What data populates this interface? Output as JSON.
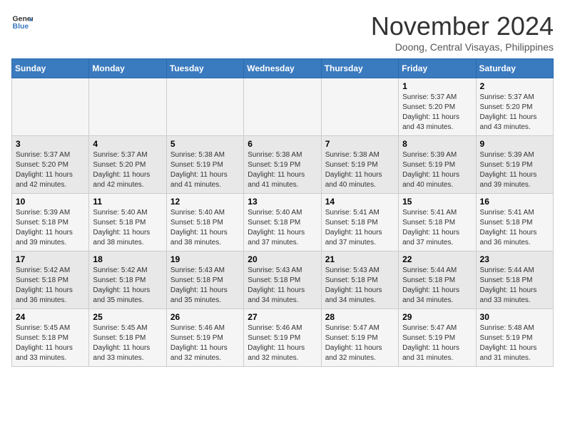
{
  "header": {
    "logo_line1": "General",
    "logo_line2": "Blue",
    "month": "November 2024",
    "location": "Doong, Central Visayas, Philippines"
  },
  "weekdays": [
    "Sunday",
    "Monday",
    "Tuesday",
    "Wednesday",
    "Thursday",
    "Friday",
    "Saturday"
  ],
  "weeks": [
    [
      {
        "day": "",
        "info": ""
      },
      {
        "day": "",
        "info": ""
      },
      {
        "day": "",
        "info": ""
      },
      {
        "day": "",
        "info": ""
      },
      {
        "day": "",
        "info": ""
      },
      {
        "day": "1",
        "info": "Sunrise: 5:37 AM\nSunset: 5:20 PM\nDaylight: 11 hours\nand 43 minutes."
      },
      {
        "day": "2",
        "info": "Sunrise: 5:37 AM\nSunset: 5:20 PM\nDaylight: 11 hours\nand 43 minutes."
      }
    ],
    [
      {
        "day": "3",
        "info": "Sunrise: 5:37 AM\nSunset: 5:20 PM\nDaylight: 11 hours\nand 42 minutes."
      },
      {
        "day": "4",
        "info": "Sunrise: 5:37 AM\nSunset: 5:20 PM\nDaylight: 11 hours\nand 42 minutes."
      },
      {
        "day": "5",
        "info": "Sunrise: 5:38 AM\nSunset: 5:19 PM\nDaylight: 11 hours\nand 41 minutes."
      },
      {
        "day": "6",
        "info": "Sunrise: 5:38 AM\nSunset: 5:19 PM\nDaylight: 11 hours\nand 41 minutes."
      },
      {
        "day": "7",
        "info": "Sunrise: 5:38 AM\nSunset: 5:19 PM\nDaylight: 11 hours\nand 40 minutes."
      },
      {
        "day": "8",
        "info": "Sunrise: 5:39 AM\nSunset: 5:19 PM\nDaylight: 11 hours\nand 40 minutes."
      },
      {
        "day": "9",
        "info": "Sunrise: 5:39 AM\nSunset: 5:19 PM\nDaylight: 11 hours\nand 39 minutes."
      }
    ],
    [
      {
        "day": "10",
        "info": "Sunrise: 5:39 AM\nSunset: 5:18 PM\nDaylight: 11 hours\nand 39 minutes."
      },
      {
        "day": "11",
        "info": "Sunrise: 5:40 AM\nSunset: 5:18 PM\nDaylight: 11 hours\nand 38 minutes."
      },
      {
        "day": "12",
        "info": "Sunrise: 5:40 AM\nSunset: 5:18 PM\nDaylight: 11 hours\nand 38 minutes."
      },
      {
        "day": "13",
        "info": "Sunrise: 5:40 AM\nSunset: 5:18 PM\nDaylight: 11 hours\nand 37 minutes."
      },
      {
        "day": "14",
        "info": "Sunrise: 5:41 AM\nSunset: 5:18 PM\nDaylight: 11 hours\nand 37 minutes."
      },
      {
        "day": "15",
        "info": "Sunrise: 5:41 AM\nSunset: 5:18 PM\nDaylight: 11 hours\nand 37 minutes."
      },
      {
        "day": "16",
        "info": "Sunrise: 5:41 AM\nSunset: 5:18 PM\nDaylight: 11 hours\nand 36 minutes."
      }
    ],
    [
      {
        "day": "17",
        "info": "Sunrise: 5:42 AM\nSunset: 5:18 PM\nDaylight: 11 hours\nand 36 minutes."
      },
      {
        "day": "18",
        "info": "Sunrise: 5:42 AM\nSunset: 5:18 PM\nDaylight: 11 hours\nand 35 minutes."
      },
      {
        "day": "19",
        "info": "Sunrise: 5:43 AM\nSunset: 5:18 PM\nDaylight: 11 hours\nand 35 minutes."
      },
      {
        "day": "20",
        "info": "Sunrise: 5:43 AM\nSunset: 5:18 PM\nDaylight: 11 hours\nand 34 minutes."
      },
      {
        "day": "21",
        "info": "Sunrise: 5:43 AM\nSunset: 5:18 PM\nDaylight: 11 hours\nand 34 minutes."
      },
      {
        "day": "22",
        "info": "Sunrise: 5:44 AM\nSunset: 5:18 PM\nDaylight: 11 hours\nand 34 minutes."
      },
      {
        "day": "23",
        "info": "Sunrise: 5:44 AM\nSunset: 5:18 PM\nDaylight: 11 hours\nand 33 minutes."
      }
    ],
    [
      {
        "day": "24",
        "info": "Sunrise: 5:45 AM\nSunset: 5:18 PM\nDaylight: 11 hours\nand 33 minutes."
      },
      {
        "day": "25",
        "info": "Sunrise: 5:45 AM\nSunset: 5:18 PM\nDaylight: 11 hours\nand 33 minutes."
      },
      {
        "day": "26",
        "info": "Sunrise: 5:46 AM\nSunset: 5:19 PM\nDaylight: 11 hours\nand 32 minutes."
      },
      {
        "day": "27",
        "info": "Sunrise: 5:46 AM\nSunset: 5:19 PM\nDaylight: 11 hours\nand 32 minutes."
      },
      {
        "day": "28",
        "info": "Sunrise: 5:47 AM\nSunset: 5:19 PM\nDaylight: 11 hours\nand 32 minutes."
      },
      {
        "day": "29",
        "info": "Sunrise: 5:47 AM\nSunset: 5:19 PM\nDaylight: 11 hours\nand 31 minutes."
      },
      {
        "day": "30",
        "info": "Sunrise: 5:48 AM\nSunset: 5:19 PM\nDaylight: 11 hours\nand 31 minutes."
      }
    ]
  ]
}
